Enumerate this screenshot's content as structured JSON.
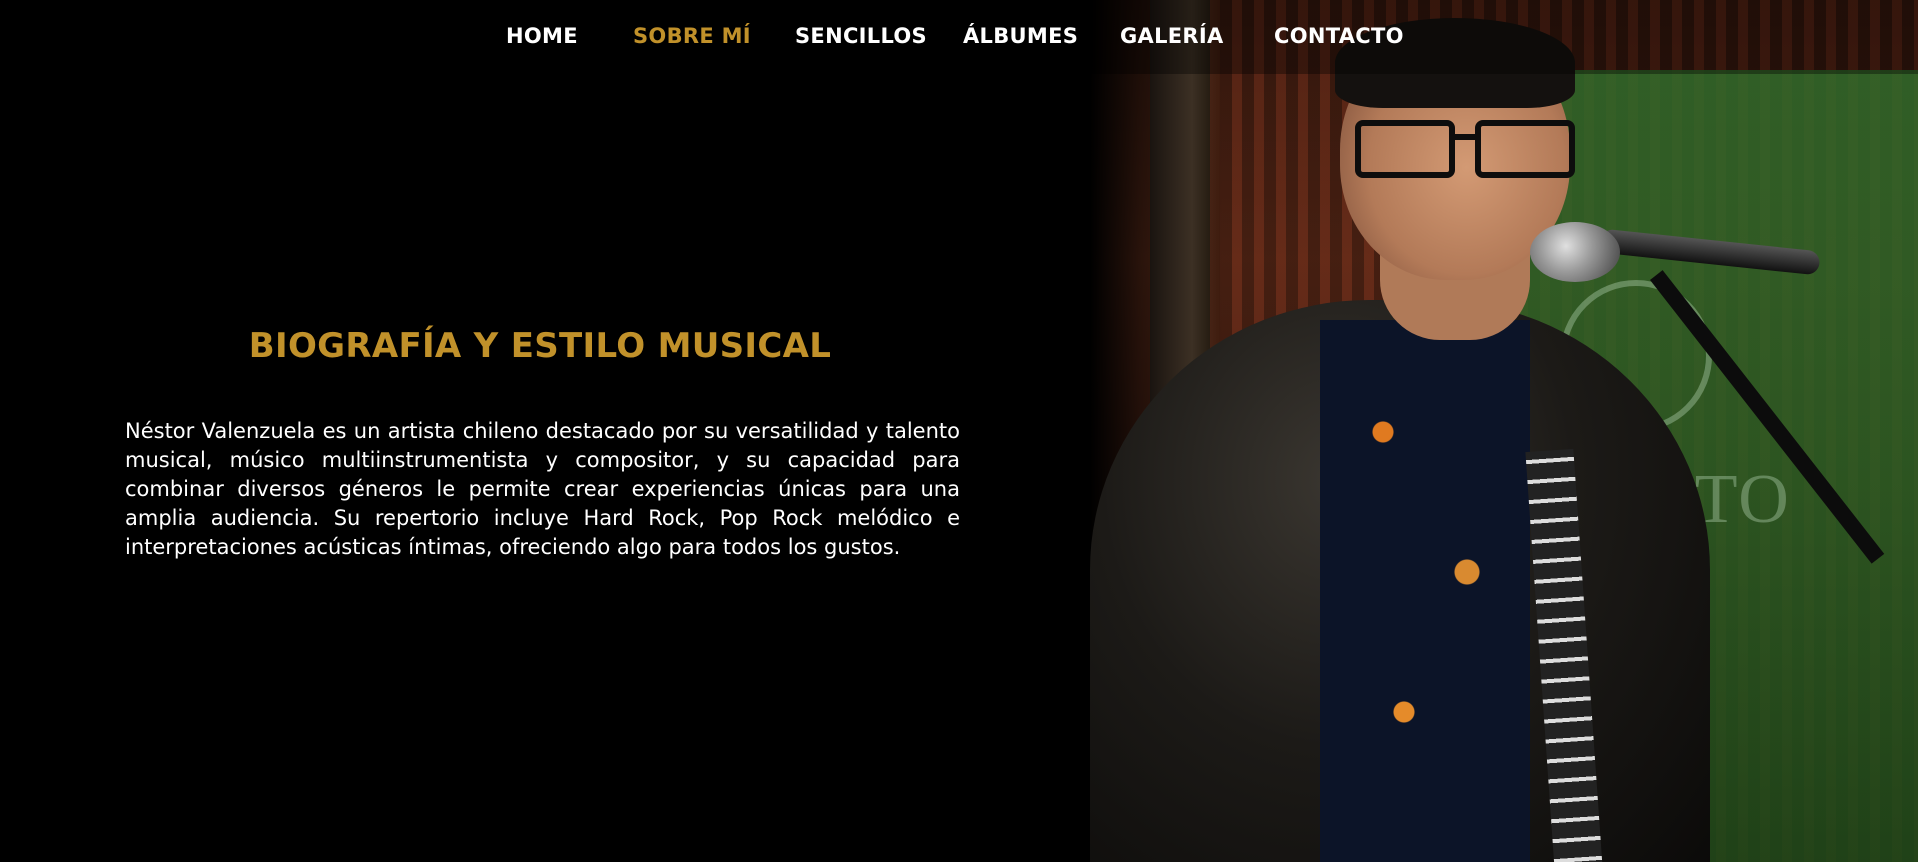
{
  "nav": {
    "items": [
      {
        "label": "HOME",
        "active": false
      },
      {
        "label": "SOBRE MÍ",
        "active": true
      },
      {
        "label": "SENCILLOS",
        "active": false
      },
      {
        "label": "ÁLBUMES",
        "active": false
      },
      {
        "label": "GALERÍA",
        "active": false
      },
      {
        "label": "CONTACTO",
        "active": false
      }
    ],
    "accent_color": "#c1912a"
  },
  "main": {
    "title": "BIOGRAFÍA Y ESTILO MUSICAL",
    "paragraph": "Néstor Valenzuela es un artista chileno destacado por su versatilidad y talento musical, músico multiinstrumentista y compositor, y su capacidad para combinar diversos géneros le permite crear experiencias únicas para una amplia audiencia. Su repertorio incluye Hard Rock, Pop Rock melódico e interpretaciones acústicas íntimas, ofreciendo algo para todos los gustos."
  },
  "photo": {
    "subject": "singer-with-microphone"
  },
  "colors": {
    "background": "#000000",
    "text": "#ffffff",
    "accent": "#c1912a"
  }
}
